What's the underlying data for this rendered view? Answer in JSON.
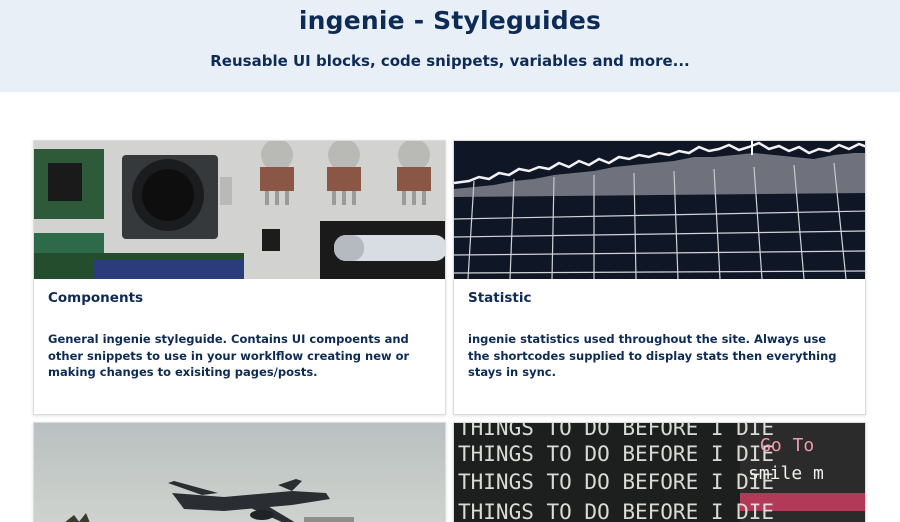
{
  "header": {
    "title": "ingenie - Styleguides",
    "subtitle": "Reusable UI blocks, code snippets, variables and more..."
  },
  "cards": [
    {
      "title": "Components",
      "description": "General ingenie styleguide. Contains UI compoents and other snippets to use in your worklflow creating new or making changes to exisiting pages/posts.",
      "image": "electronic-components-photo"
    },
    {
      "title": "Statistic",
      "description": "ingenie statistics used throughout the site. Always use the shortcodes supplied to display stats then everything stays in sync.",
      "image": "stock-chart-photo"
    },
    {
      "title": "",
      "description": "",
      "image": "airplane-takeoff-photo"
    },
    {
      "title": "",
      "description": "",
      "image": "chalkboard-photo",
      "image_text": [
        "THINGS TO DO BEFORE I DIE",
        "THINGS TO DO BEFORE I DIE",
        "THINGS TO DO BEFORE I DIE",
        "THINGS TO DO BEFORE I DIE",
        "Go To",
        "smile m"
      ]
    }
  ],
  "colors": {
    "header_bg": "#e8eff7",
    "text": "#0d2b55"
  }
}
